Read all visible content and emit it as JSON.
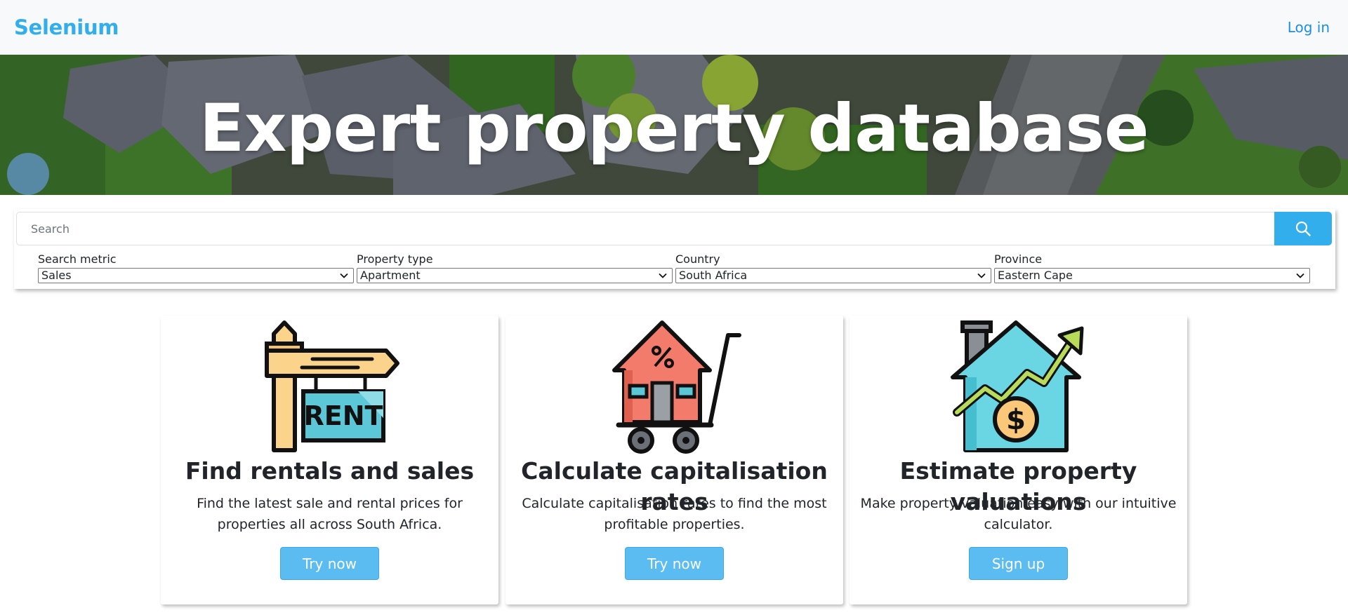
{
  "navbar": {
    "brand": "Selenium",
    "login": "Log in"
  },
  "hero": {
    "title": "Expert property database"
  },
  "search": {
    "placeholder": "Search",
    "icon": "search-icon",
    "filters": [
      {
        "label": "Search metric",
        "value": "Sales"
      },
      {
        "label": "Property type",
        "value": "Apartment"
      },
      {
        "label": "Country",
        "value": "South Africa"
      },
      {
        "label": "Province",
        "value": "Eastern Cape"
      }
    ]
  },
  "cards": [
    {
      "icon": "rent-sign-icon",
      "title": "Find rentals and sales",
      "text": "Find the latest sale and rental prices for properties all across South Africa.",
      "button": "Try now"
    },
    {
      "icon": "house-cart-icon",
      "title": "Calculate capitalisation rates",
      "text": "Calculate capitalisation rates to find the most profitable properties.",
      "button": "Try now"
    },
    {
      "icon": "house-growth-icon",
      "title": "Estimate property valuations",
      "text": "Make property valuation easy with our intuitive calculator.",
      "button": "Sign up"
    }
  ],
  "colors": {
    "accent": "#33aeed",
    "button": "#5bbcf1",
    "link": "#1c8ee6"
  }
}
